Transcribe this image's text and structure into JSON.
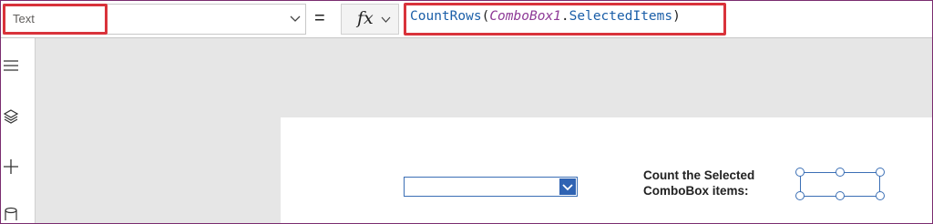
{
  "formula_bar": {
    "property": "Text",
    "equals": "=",
    "fx_label": "fx",
    "formula": {
      "function": "CountRows",
      "open_paren": "(",
      "control": "ComboBox1",
      "dot": ".",
      "property": "SelectedItems",
      "close_paren": ")"
    }
  },
  "left_rail": {
    "icons": [
      "hamburger-menu-icon",
      "layers-icon",
      "plus-icon",
      "database-icon"
    ]
  },
  "canvas": {
    "count_label": {
      "line1": "Count the Selected",
      "line2": "ComboBox items:"
    },
    "combobox_value": ""
  },
  "colors": {
    "highlight": "#d9333b",
    "function": "#1a5ea8",
    "control_ref": "#8e3a97",
    "selection": "#3b6fb5",
    "canvas_bg": "#e6e6e6"
  }
}
